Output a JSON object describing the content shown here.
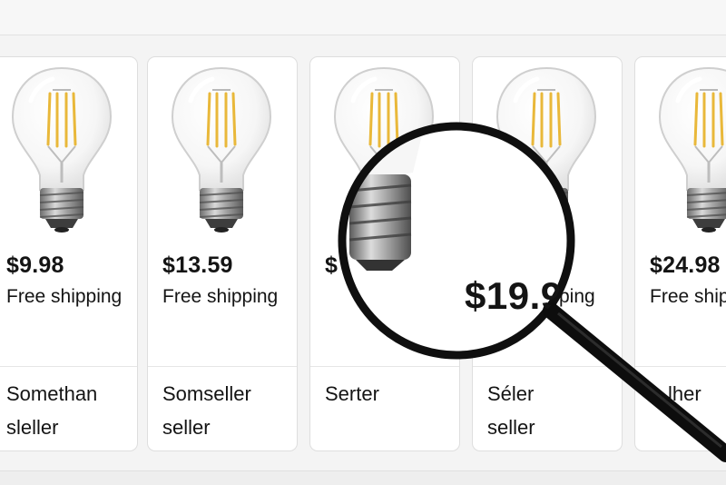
{
  "products": [
    {
      "price": "$9.98",
      "shipping": "Free shipping",
      "seller_line1": "Somethan",
      "seller_line2": "sleller"
    },
    {
      "price": "$13.59",
      "shipping": "Free shipping",
      "seller_line1": "Somseller",
      "seller_line2": "seller"
    },
    {
      "price": "$",
      "shipping": "",
      "seller_line1": "Serter",
      "seller_line2": ""
    },
    {
      "price": "",
      "shipping": "ping",
      "seller_line1": "Séler",
      "seller_line2": "seller"
    },
    {
      "price": "$24.98",
      "shipping": "Free ship",
      "seller_line1": "lher",
      "seller_line2": ""
    }
  ],
  "magnifier": {
    "magnified_price": "$19.9"
  },
  "colors": {
    "filament": "#e9b83a",
    "lens_rim": "#111111",
    "card_bg": "#ffffff"
  }
}
